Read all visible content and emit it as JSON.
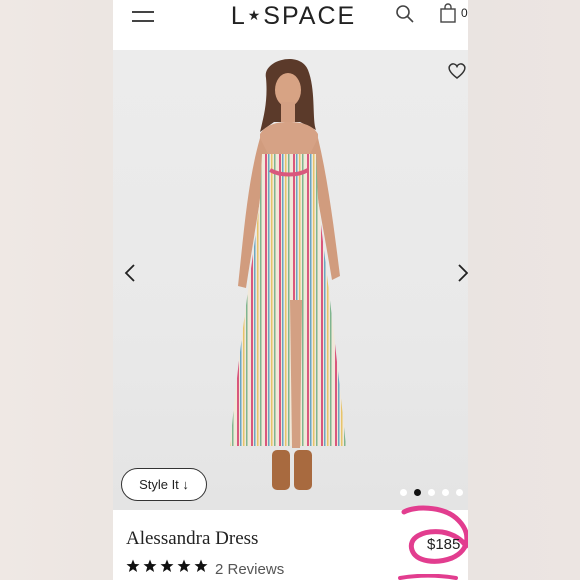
{
  "header": {
    "brand_left": "L",
    "brand_star": "★",
    "brand_right": "SPACE",
    "cart_count": "0"
  },
  "hero": {
    "style_button_label": "Style It ↓",
    "carousel_total": 5,
    "carousel_active_index": 1
  },
  "product": {
    "name": "Alessandra Dress",
    "price": "$185",
    "rating_stars": 5,
    "reviews_label": "2 Reviews"
  },
  "colors": {
    "accent_pink": "#e23d8f",
    "text": "#222222"
  },
  "icons": [
    "menu-icon",
    "search-icon",
    "shopping-bag-icon",
    "heart-icon",
    "chevron-left-icon",
    "chevron-right-icon",
    "star-icon"
  ]
}
